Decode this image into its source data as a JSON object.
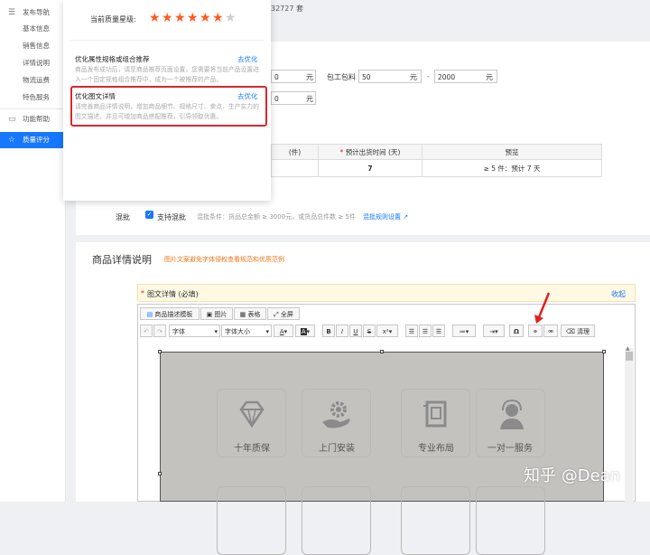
{
  "sidebar": {
    "items": [
      {
        "icon": "menu-icon",
        "label": "发布导航"
      },
      {
        "icon": "",
        "label": "基本信息"
      },
      {
        "icon": "",
        "label": "销售信息"
      },
      {
        "icon": "",
        "label": "详情说明"
      },
      {
        "icon": "",
        "label": "物流运费"
      },
      {
        "icon": "",
        "label": "特色服务"
      },
      {
        "icon": "monitor-icon",
        "label": "功能帮助"
      },
      {
        "icon": "star-icon",
        "label": "质量评分"
      }
    ],
    "active_index": 7
  },
  "top_fragment": "32727 套",
  "shipping": {
    "value1": "0",
    "unit1": "元",
    "pack_label": "包工包料",
    "value2": "50",
    "unit2": "元",
    "dash": "-",
    "value3": "2000",
    "unit3": "元",
    "value4": "0",
    "unit4": "元"
  },
  "delivery_table": {
    "col1_header": "(件)",
    "col2_header": "预计出货时间 (天)",
    "col2_required": "*",
    "col3_header": "预览",
    "col2_value": "7",
    "col3_value": "≥ 5 件：预计 7 天"
  },
  "mix": {
    "label": "混批",
    "checkbox_label": "支持混批",
    "checked": true,
    "desc": "混批条件：货品总金额 ≥ 3000元，或货品总件数 ≥ 5件",
    "link": "混批规则设置"
  },
  "detail_section": {
    "title": "商品详情说明",
    "link": "图片文案避免字体侵权查看规范和优质范例"
  },
  "editor": {
    "required_mark": "*",
    "title": "图文详情 (必填)",
    "collapse": "收起",
    "tabs": [
      "商品描述模板",
      "图片",
      "表格",
      "全屏"
    ],
    "font_select": "字体",
    "size_select": "字体大小",
    "clean_label": "清理",
    "features_row1": [
      "十年质保",
      "上门安装",
      "专业布局",
      "一对一服务"
    ]
  },
  "popup": {
    "quality_label": "当前质量星级:",
    "rating": 6,
    "max_rating": 7,
    "tips": [
      {
        "title": "优化属性规格或组合推荐",
        "link": "去优化",
        "desc": "商品发布成功后，请至商品推荐页面设置，您需要将当前产品设置进入一个固定规格组合推荐中，成为一个被推荐的产品。"
      },
      {
        "title": "优化图文详情",
        "link": "去优化",
        "desc": "请完善商品详情说明，增加商品细节、规格尺寸、卖点、生产实力的图文描述，并且可增加商品搭配推荐，引导领取优惠。"
      }
    ]
  },
  "watermark": "知乎 @Dean",
  "colors": {
    "primary": "#1677ff",
    "star": "#ff5a1f",
    "highlight_border": "#d9272e",
    "arrow": "#e02020",
    "link_orange": "#e8771b"
  }
}
